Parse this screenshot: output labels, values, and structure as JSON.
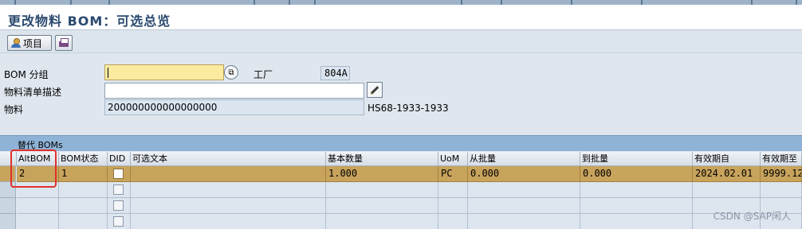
{
  "window": {
    "title": "更改物料 BOM：可选总览"
  },
  "toolbar": {
    "items_button_label": "项目"
  },
  "form": {
    "bom_group_label": "BOM 分组",
    "bom_group_value": "",
    "plant_label": "工厂",
    "plant_value": "804A",
    "material_desc_label": "物料清单描述",
    "material_desc_value": "",
    "material_label": "物料",
    "material_value": "200000000000000000",
    "material_text": "HS68-1933-1933"
  },
  "table": {
    "caption": "替代 BOMs",
    "columns": [
      "AltBOM",
      "BOM状态",
      "DID",
      "可选文本",
      "基本数量",
      "UoM",
      "从批量",
      "到批量",
      "有效期自",
      "有效期至"
    ],
    "rows": [
      {
        "altbom": "2",
        "status": "1",
        "did": "",
        "text": "",
        "base_qty": "1.000",
        "uom": "PC",
        "from_lot": "0.000",
        "to_lot": "0.000",
        "valid_from": "2024.02.01",
        "valid_to": "9999.12"
      }
    ]
  },
  "watermark": "CSDN @SAP闲人"
}
